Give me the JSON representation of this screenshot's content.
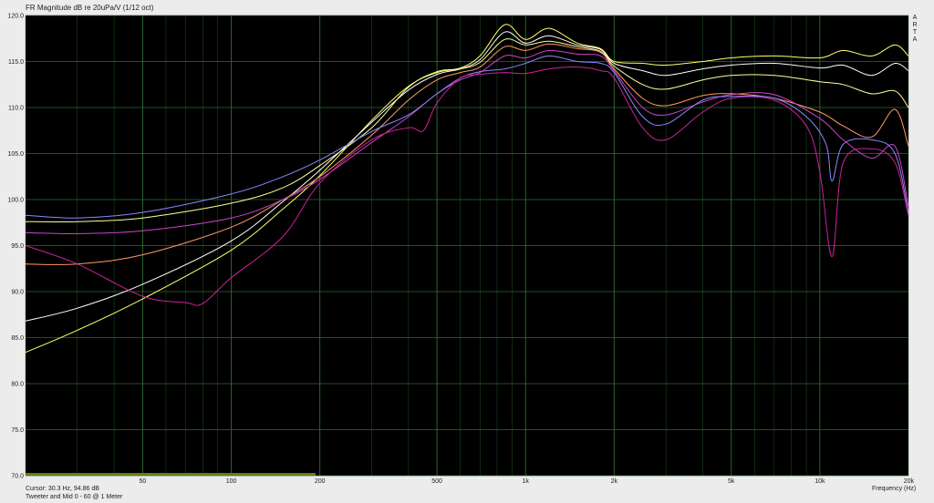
{
  "window": {
    "title": "FR Magnitude dB re 20uPa/V (1/12 oct)",
    "brand_letters": [
      "A",
      "R",
      "T",
      "A"
    ],
    "cursor_readout": "Cursor: 30.3 Hz, 94.86 dB",
    "description": "Tweeter and Mid 0 - 60 @ 1 Meter",
    "xlabel": "Frequency (Hz)"
  },
  "colors": {
    "background": "#000000",
    "grid": "#2e6b2e",
    "frame": "#ececec"
  },
  "chart_data": {
    "type": "line",
    "title": "FR Magnitude dB re 20uPa/V (1/12 oct)",
    "xlabel": "Frequency (Hz)",
    "ylabel": "",
    "x_scale": "log",
    "xlim": [
      20,
      20000
    ],
    "ylim": [
      70,
      120
    ],
    "y_ticks": [
      120.0,
      115.0,
      110.0,
      105.0,
      100.0,
      95.0,
      90.0,
      85.0,
      80.0,
      75.0,
      70.0
    ],
    "y_tick_labels": [
      "120.0",
      "115.0",
      "110.0",
      "105.0",
      "100.0",
      "95.0",
      "90.0",
      "85.0",
      "80.0",
      "75.0",
      "70.0"
    ],
    "x_ticks": [
      50,
      100,
      200,
      500,
      1000,
      2000,
      5000,
      10000,
      20000
    ],
    "x_tick_labels": [
      "50",
      "100",
      "200",
      "500",
      "1k",
      "2k",
      "5k",
      "10k",
      "20k"
    ],
    "grid": true,
    "series": [
      {
        "color": "#ffff66",
        "points": [
          [
            20,
            83.4
          ],
          [
            30,
            85.8
          ],
          [
            50,
            89.2
          ],
          [
            100,
            94.5
          ],
          [
            150,
            99.0
          ],
          [
            200,
            102.6
          ],
          [
            300,
            108.6
          ],
          [
            400,
            112.3
          ],
          [
            500,
            113.8
          ],
          [
            600,
            114.3
          ],
          [
            700,
            115.6
          ],
          [
            850,
            119.0
          ],
          [
            1000,
            117.4
          ],
          [
            1200,
            118.6
          ],
          [
            1500,
            117.0
          ],
          [
            1800,
            116.4
          ],
          [
            2000,
            115.0
          ],
          [
            2500,
            114.8
          ],
          [
            3000,
            114.6
          ],
          [
            4000,
            115.0
          ],
          [
            5000,
            115.4
          ],
          [
            7000,
            115.6
          ],
          [
            10000,
            115.4
          ],
          [
            12000,
            116.2
          ],
          [
            15000,
            115.6
          ],
          [
            18000,
            116.8
          ],
          [
            20000,
            115.6
          ]
        ]
      },
      {
        "color": "#ffffff",
        "points": [
          [
            20,
            86.8
          ],
          [
            30,
            88.2
          ],
          [
            50,
            90.8
          ],
          [
            100,
            95.5
          ],
          [
            150,
            99.8
          ],
          [
            200,
            103.2
          ],
          [
            300,
            108.4
          ],
          [
            400,
            111.9
          ],
          [
            500,
            113.6
          ],
          [
            600,
            114.2
          ],
          [
            700,
            115.2
          ],
          [
            850,
            118.2
          ],
          [
            1000,
            117.0
          ],
          [
            1200,
            117.8
          ],
          [
            1500,
            116.8
          ],
          [
            1800,
            116.3
          ],
          [
            2000,
            114.8
          ],
          [
            2500,
            114.0
          ],
          [
            3000,
            113.5
          ],
          [
            4000,
            114.2
          ],
          [
            5000,
            114.6
          ],
          [
            7000,
            114.8
          ],
          [
            10000,
            114.3
          ],
          [
            12000,
            114.6
          ],
          [
            15000,
            113.5
          ],
          [
            18000,
            114.8
          ],
          [
            20000,
            114.0
          ]
        ]
      },
      {
        "color": "#ffff99",
        "points": [
          [
            20,
            97.6
          ],
          [
            30,
            97.6
          ],
          [
            50,
            98.0
          ],
          [
            100,
            99.6
          ],
          [
            150,
            101.3
          ],
          [
            200,
            103.7
          ],
          [
            300,
            107.8
          ],
          [
            400,
            112.2
          ],
          [
            500,
            113.9
          ],
          [
            600,
            114.2
          ],
          [
            700,
            114.9
          ],
          [
            850,
            117.4
          ],
          [
            1000,
            116.8
          ],
          [
            1200,
            117.2
          ],
          [
            1500,
            116.6
          ],
          [
            1800,
            116.1
          ],
          [
            2000,
            114.5
          ],
          [
            2500,
            112.5
          ],
          [
            3000,
            112.0
          ],
          [
            4000,
            113.0
          ],
          [
            5000,
            113.5
          ],
          [
            7000,
            113.5
          ],
          [
            10000,
            112.8
          ],
          [
            12000,
            112.5
          ],
          [
            15000,
            111.5
          ],
          [
            18000,
            111.8
          ],
          [
            20000,
            110.0
          ]
        ]
      },
      {
        "color": "#ff9966",
        "points": [
          [
            20,
            93.0
          ],
          [
            30,
            93.0
          ],
          [
            50,
            94.0
          ],
          [
            100,
            97.0
          ],
          [
            150,
            100.0
          ],
          [
            200,
            102.5
          ],
          [
            300,
            107.0
          ],
          [
            400,
            110.8
          ],
          [
            500,
            113.0
          ],
          [
            600,
            113.8
          ],
          [
            700,
            114.4
          ],
          [
            850,
            116.6
          ],
          [
            1000,
            116.2
          ],
          [
            1200,
            116.9
          ],
          [
            1500,
            116.4
          ],
          [
            1800,
            116.0
          ],
          [
            2000,
            114.2
          ],
          [
            2500,
            111.0
          ],
          [
            3000,
            110.2
          ],
          [
            4000,
            111.3
          ],
          [
            5000,
            111.5
          ],
          [
            7000,
            111.0
          ],
          [
            10000,
            109.5
          ],
          [
            12000,
            108.0
          ],
          [
            15000,
            106.8
          ],
          [
            18000,
            109.8
          ],
          [
            20000,
            105.8
          ]
        ]
      },
      {
        "color": "#cc44cc",
        "points": [
          [
            20,
            96.4
          ],
          [
            30,
            96.3
          ],
          [
            50,
            96.6
          ],
          [
            100,
            98.0
          ],
          [
            150,
            100.0
          ],
          [
            200,
            102.2
          ],
          [
            300,
            106.2
          ],
          [
            400,
            109.0
          ],
          [
            500,
            111.5
          ],
          [
            600,
            113.0
          ],
          [
            700,
            113.8
          ],
          [
            850,
            115.6
          ],
          [
            1000,
            115.4
          ],
          [
            1200,
            116.2
          ],
          [
            1500,
            115.8
          ],
          [
            1800,
            115.6
          ],
          [
            2000,
            114.0
          ],
          [
            2500,
            110.0
          ],
          [
            3000,
            109.2
          ],
          [
            4000,
            110.6
          ],
          [
            5000,
            111.4
          ],
          [
            7000,
            111.4
          ],
          [
            10000,
            108.8
          ],
          [
            12000,
            106.5
          ],
          [
            15000,
            104.5
          ],
          [
            18000,
            105.8
          ],
          [
            20000,
            99.2
          ]
        ]
      },
      {
        "color": "#8888ff",
        "points": [
          [
            20,
            98.3
          ],
          [
            30,
            98.0
          ],
          [
            50,
            98.6
          ],
          [
            100,
            100.6
          ],
          [
            150,
            102.5
          ],
          [
            200,
            104.3
          ],
          [
            300,
            107.4
          ],
          [
            400,
            109.2
          ],
          [
            500,
            111.5
          ],
          [
            600,
            113.2
          ],
          [
            700,
            113.9
          ],
          [
            850,
            114.2
          ],
          [
            1000,
            114.8
          ],
          [
            1200,
            115.6
          ],
          [
            1500,
            115.0
          ],
          [
            1800,
            114.8
          ],
          [
            2000,
            113.8
          ],
          [
            2500,
            109.0
          ],
          [
            3000,
            108.2
          ],
          [
            4000,
            110.8
          ],
          [
            5000,
            111.2
          ],
          [
            7000,
            111.0
          ],
          [
            9000,
            109.0
          ],
          [
            10500,
            106.0
          ],
          [
            11000,
            102.0
          ],
          [
            12000,
            106.0
          ],
          [
            15000,
            106.5
          ],
          [
            18000,
            105.0
          ],
          [
            20000,
            98.5
          ]
        ]
      },
      {
        "color": "#cc2299",
        "points": [
          [
            20,
            95.0
          ],
          [
            30,
            93.0
          ],
          [
            50,
            89.5
          ],
          [
            70,
            88.8
          ],
          [
            80,
            88.7
          ],
          [
            100,
            91.5
          ],
          [
            150,
            96.0
          ],
          [
            200,
            101.8
          ],
          [
            300,
            106.5
          ],
          [
            400,
            107.8
          ],
          [
            450,
            107.5
          ],
          [
            500,
            110.5
          ],
          [
            600,
            113.2
          ],
          [
            700,
            113.6
          ],
          [
            850,
            113.8
          ],
          [
            1000,
            113.7
          ],
          [
            1200,
            114.2
          ],
          [
            1500,
            114.4
          ],
          [
            1800,
            114.0
          ],
          [
            2000,
            113.2
          ],
          [
            2500,
            107.8
          ],
          [
            3000,
            106.5
          ],
          [
            4000,
            109.5
          ],
          [
            5000,
            111.0
          ],
          [
            7000,
            110.8
          ],
          [
            9000,
            108.0
          ],
          [
            10000,
            103.0
          ],
          [
            11000,
            93.8
          ],
          [
            12000,
            104.0
          ],
          [
            15000,
            105.5
          ],
          [
            18000,
            104.0
          ],
          [
            20000,
            98.2
          ]
        ]
      }
    ]
  }
}
